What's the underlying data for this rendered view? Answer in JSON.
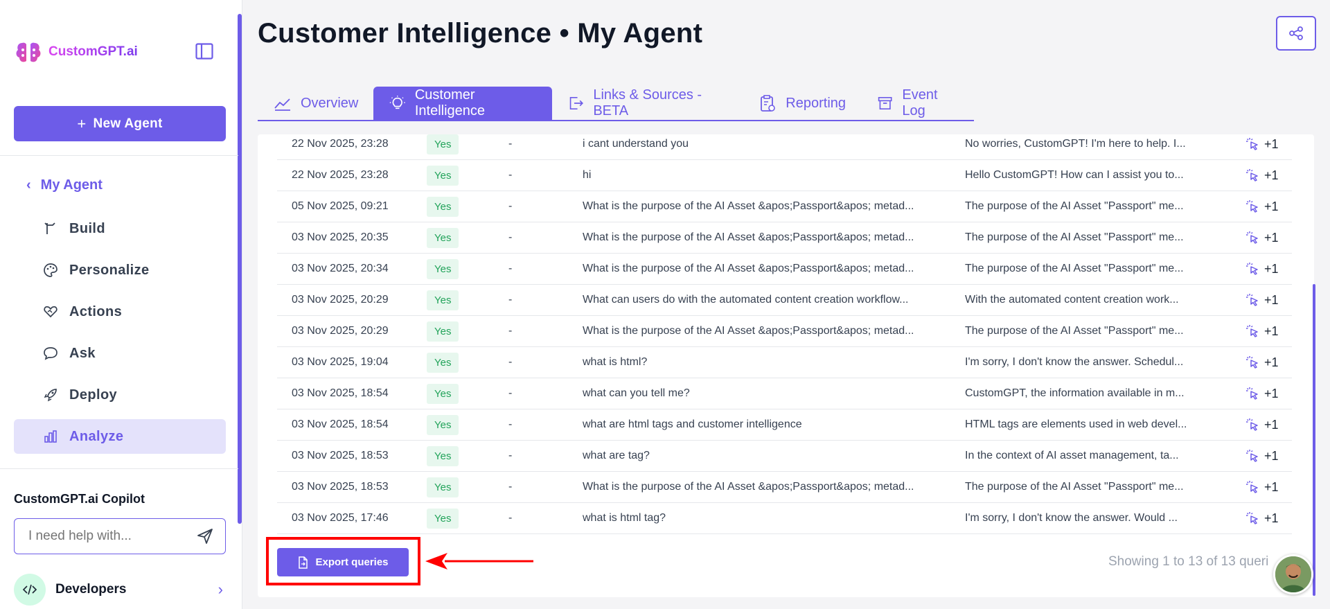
{
  "brand": {
    "name": "CustomGPT.ai"
  },
  "sidebar": {
    "new_agent_label": "New Agent",
    "agent_name": "My Agent",
    "items": [
      {
        "label": "Build",
        "icon": "build-icon"
      },
      {
        "label": "Personalize",
        "icon": "palette-icon"
      },
      {
        "label": "Actions",
        "icon": "heart-hand-icon"
      },
      {
        "label": "Ask",
        "icon": "chat-bubble-icon"
      },
      {
        "label": "Deploy",
        "icon": "rocket-icon"
      },
      {
        "label": "Analyze",
        "icon": "bar-chart-icon",
        "active": true
      }
    ],
    "copilot_title": "CustomGPT.ai Copilot",
    "copilot_placeholder": "I need help with...",
    "developers_label": "Developers"
  },
  "header": {
    "title": "Customer Intelligence • My Agent"
  },
  "tabs": [
    {
      "label": "Overview",
      "icon": "line-chart-icon"
    },
    {
      "label": "Customer Intelligence",
      "icon": "lightbulb-icon",
      "active": true
    },
    {
      "label": "Links & Sources - BETA",
      "icon": "exit-icon"
    },
    {
      "label": "Reporting",
      "icon": "clipboard-icon"
    },
    {
      "label": "Event Log",
      "icon": "archive-icon"
    }
  ],
  "table": {
    "rows": [
      {
        "date": "22 Nov 2025, 23:28",
        "status": "Yes",
        "dash": "-",
        "query": "i cant understand you",
        "answer": "No worries, CustomGPT! I'm here to help. I...",
        "count": "+1"
      },
      {
        "date": "22 Nov 2025, 23:28",
        "status": "Yes",
        "dash": "-",
        "query": "hi",
        "answer": "Hello CustomGPT! How can I assist you to...",
        "count": "+1"
      },
      {
        "date": "05 Nov 2025, 09:21",
        "status": "Yes",
        "dash": "-",
        "query": "What is the purpose of the AI Asset &apos;Passport&apos; metad...",
        "answer": "The purpose of the AI Asset \"Passport\" me...",
        "count": "+1"
      },
      {
        "date": "03 Nov 2025, 20:35",
        "status": "Yes",
        "dash": "-",
        "query": "What is the purpose of the AI Asset &apos;Passport&apos; metad...",
        "answer": "The purpose of the AI Asset \"Passport\" me...",
        "count": "+1"
      },
      {
        "date": "03 Nov 2025, 20:34",
        "status": "Yes",
        "dash": "-",
        "query": "What is the purpose of the AI Asset &apos;Passport&apos; metad...",
        "answer": "The purpose of the AI Asset \"Passport\" me...",
        "count": "+1"
      },
      {
        "date": "03 Nov 2025, 20:29",
        "status": "Yes",
        "dash": "-",
        "query": "What can users do with the automated content creation workflow...",
        "answer": "With the automated content creation work...",
        "count": "+1"
      },
      {
        "date": "03 Nov 2025, 20:29",
        "status": "Yes",
        "dash": "-",
        "query": "What is the purpose of the AI Asset &apos;Passport&apos; metad...",
        "answer": "The purpose of the AI Asset \"Passport\" me...",
        "count": "+1"
      },
      {
        "date": "03 Nov 2025, 19:04",
        "status": "Yes",
        "dash": "-",
        "query": "what is html?",
        "answer": "I'm sorry, I don't know the answer. Schedul...",
        "count": "+1"
      },
      {
        "date": "03 Nov 2025, 18:54",
        "status": "Yes",
        "dash": "-",
        "query": "what can you tell me?",
        "answer": "CustomGPT, the information available in m...",
        "count": "+1"
      },
      {
        "date": "03 Nov 2025, 18:54",
        "status": "Yes",
        "dash": "-",
        "query": "what are html tags and customer intelligence",
        "answer": "HTML tags are elements used in web devel...",
        "count": "+1"
      },
      {
        "date": "03 Nov 2025, 18:53",
        "status": "Yes",
        "dash": "-",
        "query": "what are tag?",
        "answer": "In the context of AI asset management, ta...",
        "count": "+1"
      },
      {
        "date": "03 Nov 2025, 18:53",
        "status": "Yes",
        "dash": "-",
        "query": "What is the purpose of the AI Asset &apos;Passport&apos; metad...",
        "answer": "The purpose of the AI Asset \"Passport\" me...",
        "count": "+1"
      },
      {
        "date": "03 Nov 2025, 17:46",
        "status": "Yes",
        "dash": "-",
        "query": "what is html tag?",
        "answer": "I'm sorry, I don't know the answer. Would ...",
        "count": "+1"
      }
    ]
  },
  "footer": {
    "export_label": "Export queries",
    "showing_text": "Showing 1 to 13 of 13 queri"
  },
  "colors": {
    "accent": "#6d5ce8",
    "highlight": "#ff0000",
    "success": "#22a35a"
  }
}
